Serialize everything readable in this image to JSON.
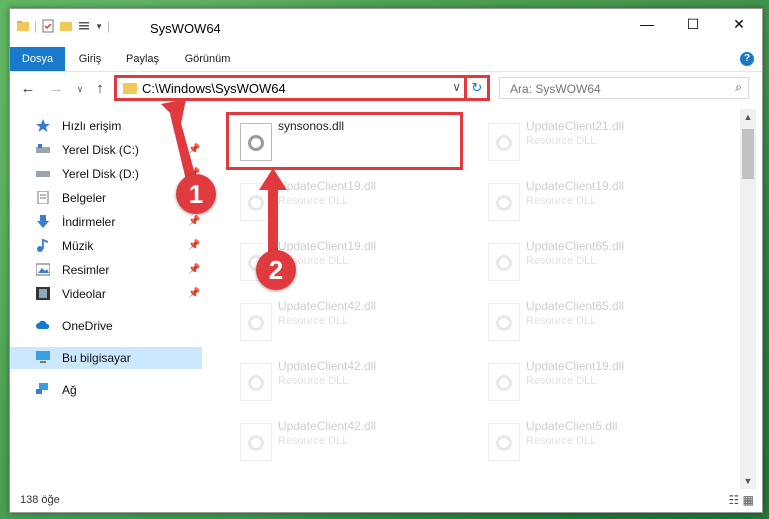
{
  "window": {
    "title": "SysWOW64"
  },
  "ribbon": {
    "tabs": [
      {
        "label": "Dosya",
        "active": true
      },
      {
        "label": "Giriş"
      },
      {
        "label": "Paylaş"
      },
      {
        "label": "Görünüm"
      }
    ]
  },
  "address": {
    "path": "C:\\Windows\\SysWOW64"
  },
  "search": {
    "placeholder": "Ara: SysWOW64"
  },
  "sidebar": {
    "items": [
      {
        "label": "Hızlı erişim",
        "icon": "star-icon"
      },
      {
        "label": "Yerel Disk (C:)",
        "icon": "drive-icon",
        "pinned": true
      },
      {
        "label": "Yerel Disk (D:)",
        "icon": "drive-icon",
        "pinned": true
      },
      {
        "label": "Belgeler",
        "icon": "documents-icon",
        "pinned": true
      },
      {
        "label": "İndirmeler",
        "icon": "download-icon",
        "pinned": true
      },
      {
        "label": "Müzik",
        "icon": "music-icon",
        "pinned": true
      },
      {
        "label": "Resimler",
        "icon": "pictures-icon",
        "pinned": true
      },
      {
        "label": "Videolar",
        "icon": "videos-icon",
        "pinned": true
      },
      {
        "label": "OneDrive",
        "icon": "cloud-icon"
      },
      {
        "label": "Bu bilgisayar",
        "icon": "computer-icon",
        "selected": true
      },
      {
        "label": "Ağ",
        "icon": "network-icon"
      }
    ]
  },
  "files": [
    {
      "name": "synsonos.dll",
      "type": ""
    },
    {
      "name": "UpdateClient21.dll",
      "type": "Resource DLL"
    },
    {
      "name": "UpdateClient19.dll",
      "type": "Resource DLL"
    },
    {
      "name": "UpdateClient19.dll",
      "type": "Resource DLL"
    },
    {
      "name": "UpdateClient19.dll",
      "type": "Resource DLL"
    },
    {
      "name": "UpdateClient65.dll",
      "type": "Resource DLL"
    },
    {
      "name": "UpdateClient42.dll",
      "type": "Resource DLL"
    },
    {
      "name": "UpdateClient65.dll",
      "type": "Resource DLL"
    },
    {
      "name": "UpdateClient42.dll",
      "type": "Resource DLL"
    },
    {
      "name": "UpdateClient19.dll",
      "type": "Resource DLL"
    },
    {
      "name": "UpdateClient42.dll",
      "type": "Resource DLL"
    },
    {
      "name": "UpdateClient5.dll",
      "type": "Resource DLL"
    }
  ],
  "status": {
    "count": "138 öğe"
  },
  "markers": {
    "one": "1",
    "two": "2"
  },
  "colors": {
    "accent": "#1979ca",
    "highlight": "#e03a3e",
    "selected": "#cce8ff"
  }
}
